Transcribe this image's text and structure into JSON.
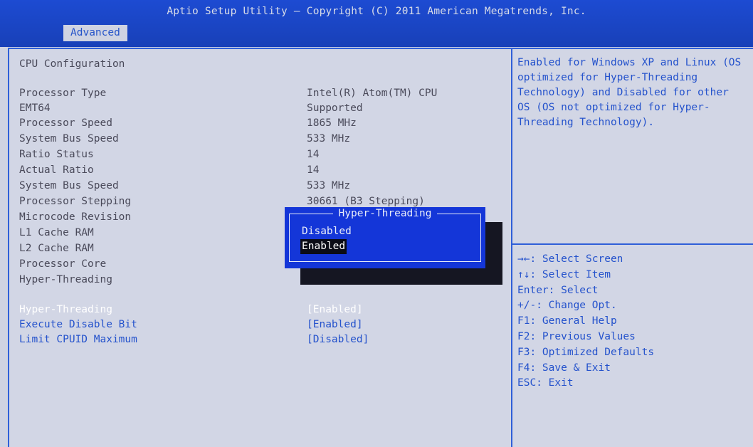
{
  "header": {
    "title": "Aptio Setup Utility – Copyright (C) 2011 American Megatrends, Inc.",
    "tab": "Advanced"
  },
  "main": {
    "heading": "CPU Configuration",
    "info": [
      {
        "label": "Processor Type",
        "value": "Intel(R) Atom(TM) CPU"
      },
      {
        "label": "EMT64",
        "value": "Supported"
      },
      {
        "label": "Processor Speed",
        "value": "1865 MHz"
      },
      {
        "label": "System Bus Speed",
        "value": "533 MHz"
      },
      {
        "label": "Ratio Status",
        "value": "14"
      },
      {
        "label": "Actual Ratio",
        "value": "14"
      },
      {
        "label": "System Bus Speed",
        "value": "533 MHz"
      },
      {
        "label": "Processor Stepping",
        "value": "30661 (B3 Stepping)"
      },
      {
        "label": "Microcode Revision",
        "value": ""
      },
      {
        "label": "L1 Cache RAM",
        "value": ""
      },
      {
        "label": "L2 Cache RAM",
        "value": ""
      },
      {
        "label": "Processor Core",
        "value": ""
      },
      {
        "label": "Hyper-Threading",
        "value": ""
      }
    ],
    "options": [
      {
        "label": "Hyper-Threading",
        "value": "[Enabled]"
      },
      {
        "label": "Execute Disable Bit",
        "value": "[Enabled]"
      },
      {
        "label": "Limit CPUID Maximum",
        "value": "[Disabled]"
      }
    ]
  },
  "popup": {
    "title": "Hyper-Threading",
    "items": [
      "Disabled",
      "Enabled"
    ],
    "selected": "Enabled"
  },
  "help": {
    "text": "Enabled for Windows XP and Linux (OS optimized for Hyper-Threading Technology) and Disabled for other OS (OS not optimized for Hyper-Threading Technology).",
    "keys": [
      "→←: Select Screen",
      "↑↓: Select Item",
      "Enter: Select",
      "+/-: Change Opt.",
      "F1: General Help",
      "F2: Previous Values",
      "F3: Optimized Defaults",
      "F4: Save & Exit",
      "ESC: Exit"
    ]
  },
  "colors": {
    "header_bg": "#1d4bd2",
    "panel_bg": "#d2d6e5",
    "accent_blue": "#2452cc",
    "popup_bg": "#1436d8"
  }
}
